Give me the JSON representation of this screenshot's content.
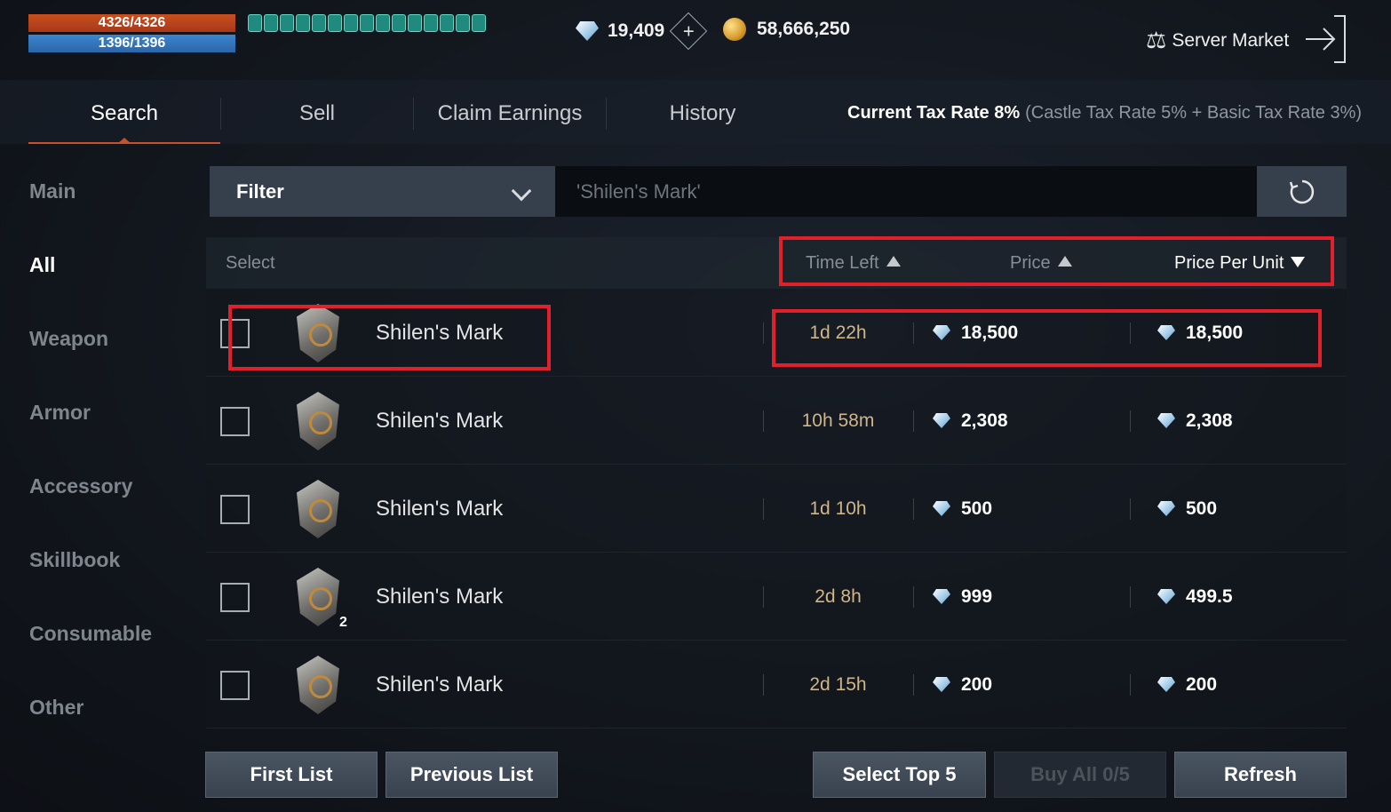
{
  "hud": {
    "hp": "4326/4326",
    "mp": "1396/1396",
    "diamonds": "19,409",
    "adena": "58,666,250",
    "server_market": "Server Market"
  },
  "tabs": [
    {
      "label": "Search",
      "active": true
    },
    {
      "label": "Sell",
      "active": false
    },
    {
      "label": "Claim Earnings",
      "active": false
    },
    {
      "label": "History",
      "active": false
    }
  ],
  "tax": {
    "label": "Current Tax Rate 8%",
    "detail": "(Castle Tax Rate 5% + Basic Tax Rate 3%)"
  },
  "sidebar": {
    "items": [
      "Main",
      "All",
      "Weapon",
      "Armor",
      "Accessory",
      "Skillbook",
      "Consumable",
      "Other"
    ],
    "active": "All"
  },
  "filter": {
    "label": "Filter",
    "search_text": "'Shilen's Mark'"
  },
  "table": {
    "headers": {
      "select": "Select",
      "time_left": "Time Left",
      "price": "Price",
      "price_per_unit": "Price Per Unit"
    },
    "rows": [
      {
        "name": "Shilen's Mark",
        "time": "1d 22h",
        "price": "18,500",
        "ppu": "18,500",
        "qty": ""
      },
      {
        "name": "Shilen's Mark",
        "time": "10h 58m",
        "price": "2,308",
        "ppu": "2,308",
        "qty": ""
      },
      {
        "name": "Shilen's Mark",
        "time": "1d 10h",
        "price": "500",
        "ppu": "500",
        "qty": ""
      },
      {
        "name": "Shilen's Mark",
        "time": "2d 8h",
        "price": "999",
        "ppu": "499.5",
        "qty": "2"
      },
      {
        "name": "Shilen's Mark",
        "time": "2d 15h",
        "price": "200",
        "ppu": "200",
        "qty": ""
      }
    ]
  },
  "buttons": {
    "first_list": "First List",
    "previous_list": "Previous List",
    "select_top5": "Select Top 5",
    "buy_all": "Buy All 0/5",
    "refresh": "Refresh"
  },
  "colors": {
    "highlight": "#e0202a",
    "hp_bar": "#c8501e",
    "mp_bar": "#3c85cf",
    "time_text": "#cfb588"
  }
}
